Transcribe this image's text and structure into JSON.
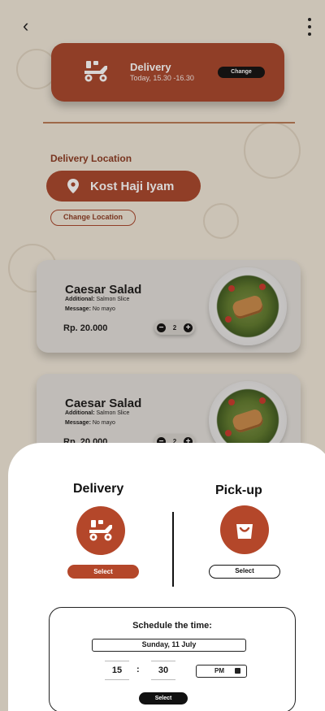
{
  "header": {
    "back_icon": "chevron-left-icon",
    "more_icon": "more-vertical-icon"
  },
  "delivery_card": {
    "title": "Delivery",
    "time": "Today, 15.30 -16.30",
    "change_label": "Change",
    "icon": "scooter-icon"
  },
  "location": {
    "title": "Delivery Location",
    "name": "Kost Haji Iyam",
    "change_label": "Change Location",
    "icon": "location-pin-icon"
  },
  "orders": [
    {
      "name": "Caesar Salad",
      "additional_label": "Additional:",
      "additional_value": "Salmon Slice",
      "message_label": "Message:",
      "message_value": "No mayo",
      "price": "Rp. 20.000",
      "quantity": "2",
      "minus": "−",
      "plus": "+"
    },
    {
      "name": "Caesar Salad",
      "additional_label": "Additional:",
      "additional_value": "Salmon Slice",
      "message_label": "Message:",
      "message_value": "No mayo",
      "price": "Rp. 20.000",
      "quantity": "2",
      "minus": "−",
      "plus": "+"
    }
  ],
  "sheet": {
    "delivery": {
      "title": "Delivery",
      "icon": "scooter-icon",
      "select_label": "Select"
    },
    "pickup": {
      "title": "Pick-up",
      "icon": "shopping-bag-icon",
      "select_label": "Select"
    },
    "schedule": {
      "title": "Schedule the time:",
      "date": "Sunday, 11 July",
      "hour": "15",
      "separator": ":",
      "minute": "30",
      "period": "PM",
      "select_label": "Select"
    }
  },
  "colors": {
    "accent": "#a8462b",
    "background": "#efe8da",
    "dark": "#111111"
  }
}
